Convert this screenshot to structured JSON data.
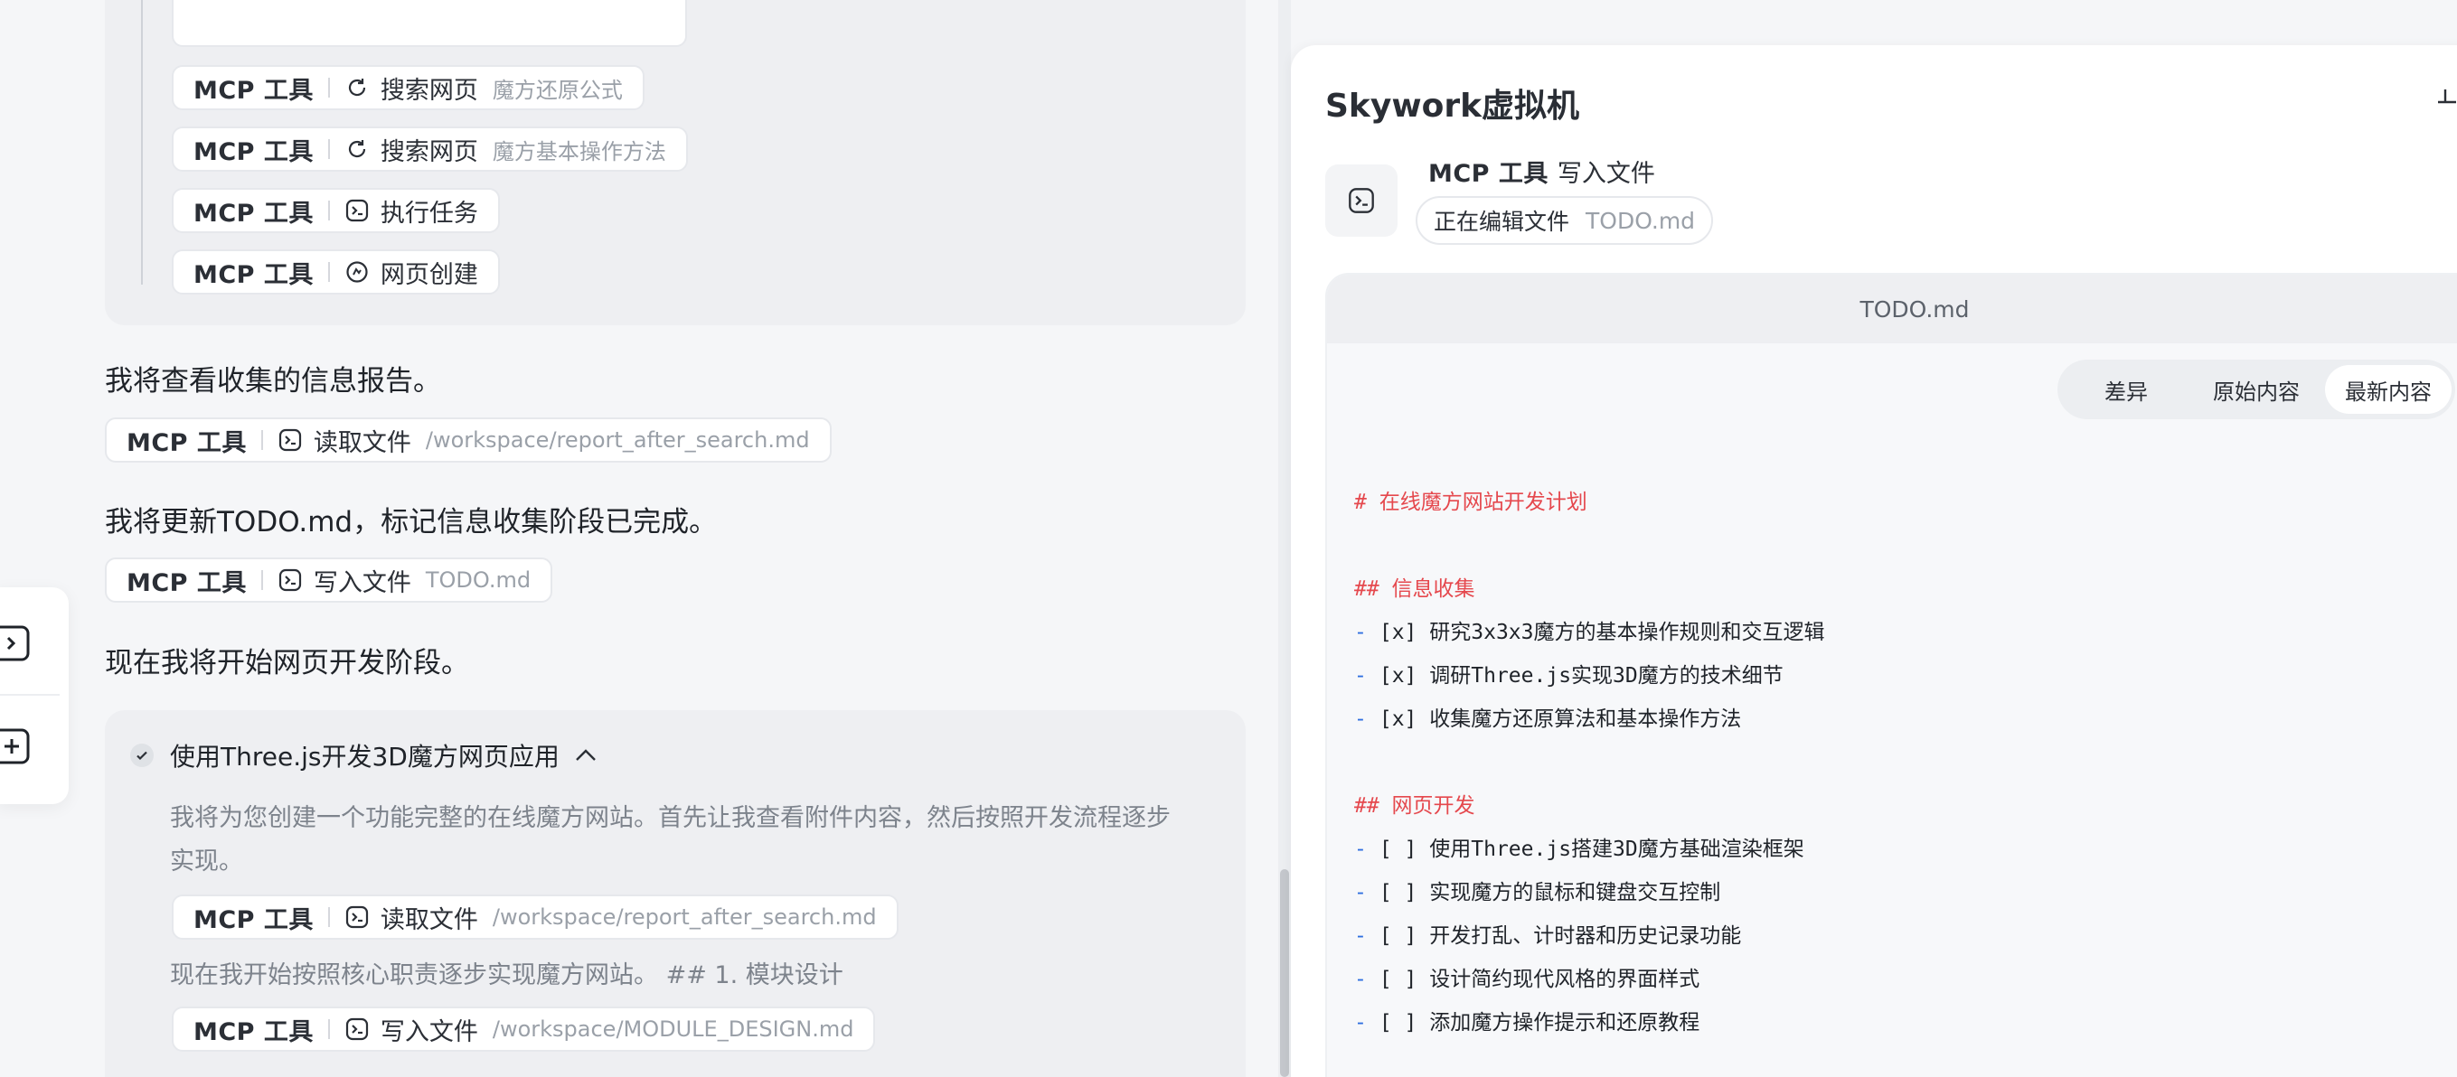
{
  "chat": {
    "tool_calls_top": [
      {
        "mcp": "MCP 工具",
        "action": "搜索网页",
        "arg": "魔方还原公式",
        "icon": "refresh-search-icon"
      },
      {
        "mcp": "MCP 工具",
        "action": "搜索网页",
        "arg": "魔方基本操作方法",
        "icon": "refresh-search-icon"
      },
      {
        "mcp": "MCP 工具",
        "action": "执行任务",
        "arg": "",
        "icon": "terminal-icon"
      },
      {
        "mcp": "MCP 工具",
        "action": "网页创建",
        "arg": "",
        "icon": "web-create-icon"
      }
    ],
    "msg_view_report": "我将查看收集的信息报告。",
    "tool_read_report": {
      "mcp": "MCP 工具",
      "action": "读取文件",
      "arg": "/workspace/report_after_search.md"
    },
    "msg_update_todo": "我将更新TODO.md，标记信息收集阶段已完成。",
    "tool_write_todo": {
      "mcp": "MCP 工具",
      "action": "写入文件",
      "arg": "TODO.md"
    },
    "msg_start_dev": "现在我将开始网页开发阶段。",
    "task": {
      "title": "使用Three.js开发3D魔方网页应用",
      "desc_line1": "我将为您创建一个功能完整的在线魔方网站。首先让我查看附件内容，然后按照开发流程逐步",
      "desc_line2": "实现。",
      "tool_read": {
        "mcp": "MCP 工具",
        "action": "读取文件",
        "arg": "/workspace/report_after_search.md"
      },
      "step_text": "现在我开始按照核心职责逐步实现魔方网站。 ## 1. 模块设计",
      "tool_write": {
        "mcp": "MCP 工具",
        "action": "写入文件",
        "arg": "/workspace/MODULE_DESIGN.md"
      }
    }
  },
  "vm": {
    "title": "Skywork虚拟机",
    "tool_mcp": "MCP 工具",
    "tool_action": "写入文件",
    "editing_label": "正在编辑文件",
    "editing_file": "TODO.md",
    "file_name": "TODO.md",
    "tabs": [
      "差异",
      "原始内容",
      "最新内容"
    ],
    "active_tab": "最新内容",
    "md": {
      "h1": "# 在线魔方网站开发计划",
      "h2_info": "## 信息收集",
      "info_items": [
        {
          "box": "[x]",
          "text": "研究3x3x3魔方的基本操作规则和交互逻辑"
        },
        {
          "box": "[x]",
          "text": "调研Three.js实现3D魔方的技术细节"
        },
        {
          "box": "[x]",
          "text": "收集魔方还原算法和基本操作方法"
        }
      ],
      "h2_dev": "## 网页开发",
      "dev_items": [
        {
          "box": "[ ]",
          "text": "使用Three.js搭建3D魔方基础渲染框架"
        },
        {
          "box": "[ ]",
          "text": "实现魔方的鼠标和键盘交互控制"
        },
        {
          "box": "[ ]",
          "text": "开发打乱、计时器和历史记录功能"
        },
        {
          "box": "[ ]",
          "text": "设计简约现代风格的界面样式"
        },
        {
          "box": "[ ]",
          "text": "添加魔方操作提示和还原教程"
        }
      ]
    }
  },
  "colors": {
    "heading_red": "#e5484d",
    "list_dash_blue": "#2f6fe0",
    "muted_text": "#9aa0a8"
  }
}
